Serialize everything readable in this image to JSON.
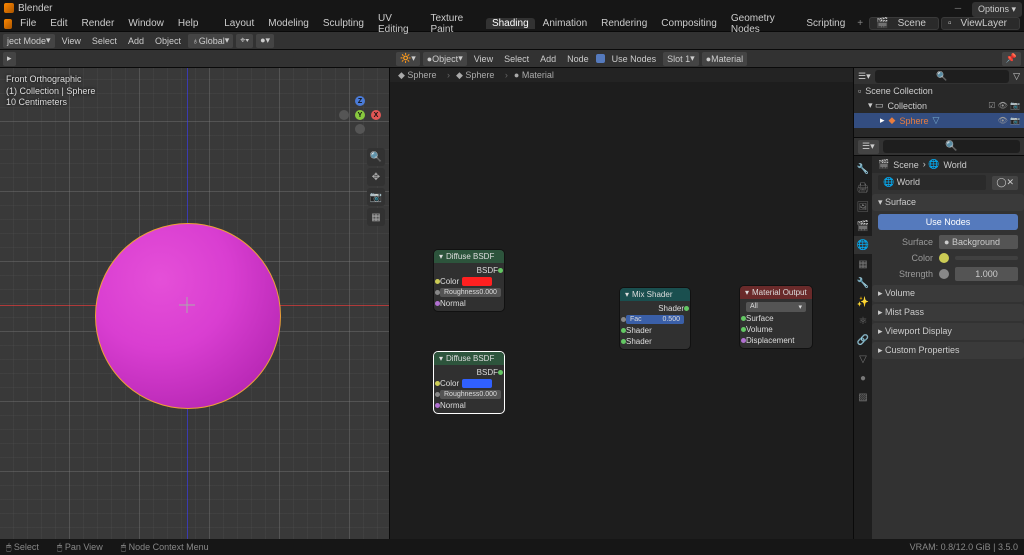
{
  "app": {
    "title": "Blender"
  },
  "menus": {
    "file": "File",
    "edit": "Edit",
    "render": "Render",
    "window": "Window",
    "help": "Help"
  },
  "workspaces": {
    "tabs": [
      "Layout",
      "Modeling",
      "Sculpting",
      "UV Editing",
      "Texture Paint",
      "Shading",
      "Animation",
      "Rendering",
      "Compositing",
      "Geometry Nodes",
      "Scripting"
    ],
    "active": "Shading",
    "scene": "Scene",
    "viewlayer": "ViewLayer"
  },
  "viewport_header": {
    "mode": "ject Mode",
    "view": "View",
    "select": "Select",
    "add": "Add",
    "object": "Object",
    "orientation": "Global"
  },
  "viewport_overlay": {
    "line1": "Front Orthographic",
    "line2": "(1) Collection | Sphere",
    "line3": "10 Centimeters"
  },
  "gizmo": {
    "x": "X",
    "y": "Y",
    "z": "Z"
  },
  "options_label": "Options",
  "node_header": {
    "view": "View",
    "select": "Select",
    "add": "Add",
    "node": "Node",
    "use_nodes_label": "Use Nodes",
    "object": "Object",
    "obj_name": "Sphere",
    "slot": "Slot 1",
    "mat": "Material"
  },
  "breadcrumb": {
    "a": "Sphere",
    "b": "Sphere",
    "c": "Material"
  },
  "nodes": {
    "diffuse1": {
      "title": "Diffuse BSDF",
      "bsdf": "BSDF",
      "color": "Color",
      "color_hex": "#ff2020",
      "rough_label": "Roughness",
      "rough": "0.000",
      "normal": "Normal"
    },
    "diffuse2": {
      "title": "Diffuse BSDF",
      "bsdf": "BSDF",
      "color": "Color",
      "color_hex": "#3060ff",
      "rough_label": "Roughness",
      "rough": "0.000",
      "normal": "Normal"
    },
    "mix": {
      "title": "Mix Shader",
      "out": "Shader",
      "fac_label": "Fac",
      "fac": "0.500",
      "in1": "Shader",
      "in2": "Shader"
    },
    "output": {
      "title": "Material Output",
      "target": "All",
      "surface": "Surface",
      "volume": "Volume",
      "disp": "Displacement"
    }
  },
  "outliner": {
    "title": "Scene Collection",
    "collection": "Collection",
    "item": "Sphere"
  },
  "properties": {
    "breadcrumb_scene": "Scene",
    "breadcrumb_world": "World",
    "world": "World",
    "surface_sect": "Surface",
    "use_nodes_btn": "Use Nodes",
    "surface_lbl": "Surface",
    "surface_val": "Background",
    "color_lbl": "Color",
    "strength_lbl": "Strength",
    "strength_val": "1.000",
    "sections": [
      "Volume",
      "Mist Pass",
      "Viewport Display",
      "Custom Properties"
    ]
  },
  "status": {
    "select": "Select",
    "pan": "Pan View",
    "ctx": "Node Context Menu",
    "vram": "VRAM: 0.8/12.0 GiB | 3.5.0"
  }
}
